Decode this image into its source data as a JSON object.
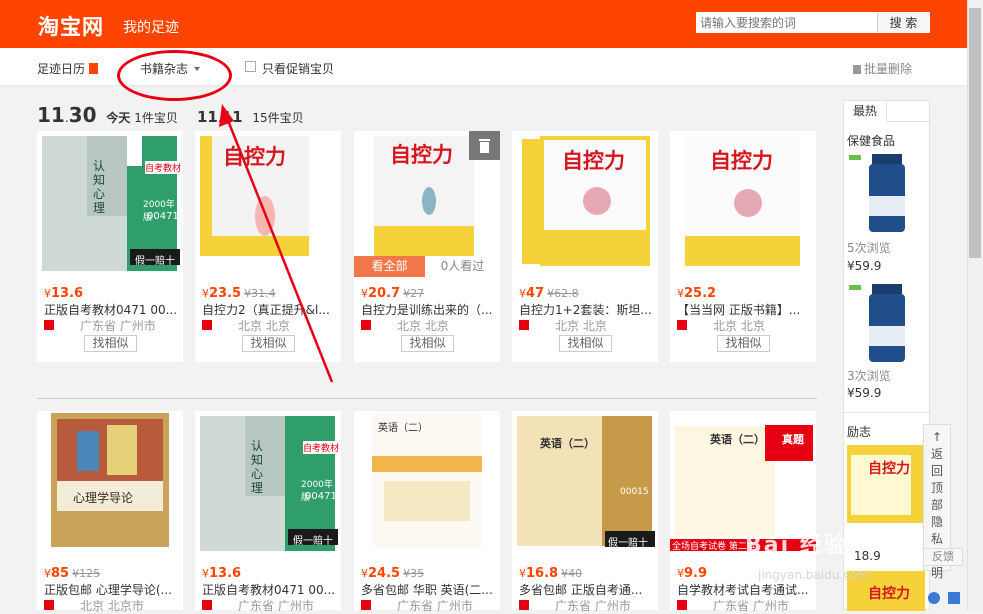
{
  "header": {
    "logo": "淘宝网",
    "subtitle": "我的足迹",
    "search_placeholder": "请输入要搜索的词",
    "search_button": "搜 索"
  },
  "filter": {
    "calendar": "足迹日历",
    "category": "书籍杂志",
    "promo_only": "只看促销宝贝",
    "batch_delete": "批量删除"
  },
  "dates": [
    {
      "day": "11",
      "sep": ".",
      "date": "30",
      "label": "今天",
      "count": "1件宝贝"
    },
    {
      "day": "11",
      "sep": ".",
      "date": "11",
      "label": "",
      "count": "15件宝贝"
    }
  ],
  "row1": [
    {
      "price": "13.6",
      "old": "",
      "title": "正版自考教材0471 00...",
      "loc": "广东省 广州市",
      "sim": "找相似"
    },
    {
      "price": "23.5",
      "old": "31.4",
      "title": "自控力2（真正提升&l...",
      "loc": "北京 北京",
      "sim": "找相似"
    },
    {
      "price": "20.7",
      "old": "27",
      "title": "自控力是训练出来的（...",
      "loc": "北京 北京",
      "sim": "找相似",
      "see_all": "看全部",
      "viewed": "0人看过"
    },
    {
      "price": "47",
      "old": "62.8",
      "title": "自控力1+2套装：斯坦...",
      "loc": "北京 北京",
      "sim": "找相似"
    },
    {
      "price": "25.2",
      "old": "",
      "title": "【当当网 正版书籍】...",
      "loc": "北京 北京",
      "sim": "找相似"
    }
  ],
  "row2": [
    {
      "price": "85",
      "old": "125",
      "title": "正版包邮 心理学导论(...",
      "loc": "北京 北京市",
      "img_title": "心理学导论"
    },
    {
      "price": "13.6",
      "old": "",
      "title": "正版自考教材0471 00...",
      "loc": "广东省 广州市"
    },
    {
      "price": "24.5",
      "old": "35",
      "title": "多省包邮 华职 英语(二...",
      "loc": "广东省 广州市"
    },
    {
      "price": "16.8",
      "old": "40",
      "title": "多省包邮 正版自考通...",
      "loc": "广东省 广州市"
    },
    {
      "price": "9.9",
      "old": "",
      "title": "自学教材考试自考通试...",
      "loc": "广东省 广州市"
    }
  ],
  "sidebar": {
    "tab": "最热",
    "cat1": "保健食品",
    "views1": "5次浏览",
    "price1": "¥59.9",
    "views2": "3次浏览",
    "price2": "¥59.9",
    "cat2": "励志",
    "price3": "18.9"
  },
  "book_art": {
    "self_control": "自控力",
    "psych": "认知心理",
    "exam_tag": "自考教材",
    "year": "2000年版",
    "code": "00471",
    "fake": "假一赔十",
    "english": "英语（二）",
    "english_code": "00015",
    "real_q": "真题",
    "full_set": "全场自考试卷 第二本",
    "psych_intro": "心理学导论"
  },
  "float": {
    "back_top": "返回顶部",
    "privacy": "隐私声明",
    "feedback": "反馈"
  },
  "watermark": "Bai 经验",
  "watermark_url": "jingyan.baidu.com",
  "currency": "¥",
  "colors": {
    "brand": "#ff4400",
    "annotation": "#e60012"
  }
}
